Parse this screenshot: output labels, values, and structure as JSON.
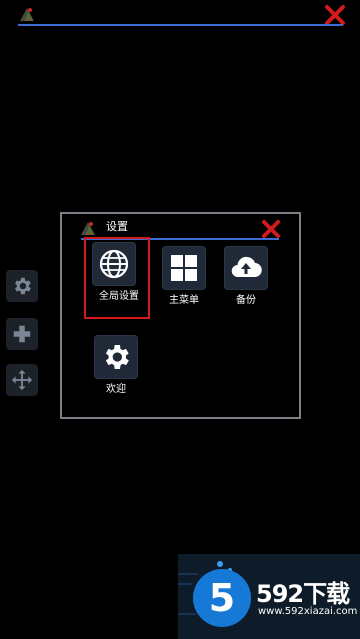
{
  "top_bar": {
    "logo_icon": "app-logo-icon",
    "close_icon": "close-icon",
    "accent": "#3f6bd6",
    "close_color": "#d21a1a"
  },
  "side_toolbar": [
    {
      "name": "gear-icon"
    },
    {
      "name": "plus-icon"
    },
    {
      "name": "move-arrows-icon"
    }
  ],
  "dialog": {
    "title": "设置",
    "tiles": [
      {
        "label": "全局设置",
        "icon": "globe-icon",
        "selected": true
      },
      {
        "label": "主菜单",
        "icon": "grid-icon",
        "selected": false
      },
      {
        "label": "备份",
        "icon": "cloud-upload-icon",
        "selected": false
      },
      {
        "label": "欢迎",
        "icon": "gear-icon",
        "selected": false
      }
    ]
  },
  "watermark": {
    "brand": "592下载",
    "url": "www.592xiazai.com",
    "digit": "5",
    "color": "#1679d6"
  }
}
